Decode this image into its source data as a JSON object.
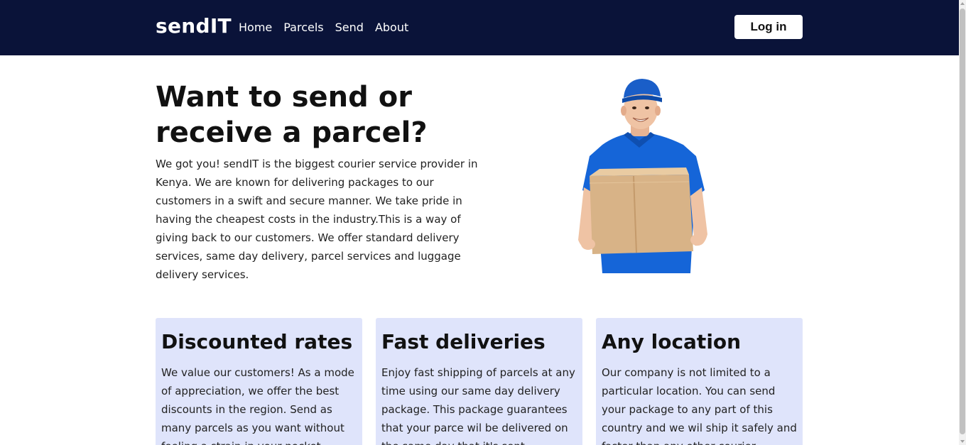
{
  "navbar": {
    "brand": "sendIT",
    "links": [
      "Home",
      "Parcels",
      "Send",
      "About"
    ],
    "login_label": "Log in",
    "background_color": "#0a1339"
  },
  "hero": {
    "title_line1": "Want to send or",
    "title_line2": "receive a parcel?",
    "description": "We got you! sendIT is the biggest courier service provider in Kenya. We are known for delivering packages to our customers in a swift and secure manner. We take pride in having the cheapest costs in the industry.This is a way of giving back to our customers. We offer standard delivery services, same day delivery, parcel services and luggage delivery services.",
    "image": "delivery-man-holding-box"
  },
  "features": [
    {
      "title": "Discounted rates",
      "text": "We value our customers! As a mode of appreciation, we offer the best discounts in the region. Send as many parcels as you want without feeling a strain in your pocket."
    },
    {
      "title": "Fast deliveries",
      "text": "Enjoy fast shipping of parcels at any time using our same day delivery package. This package guarantees that your parce wil be delivered on the same day that it's sent."
    },
    {
      "title": "Any location",
      "text": "Our company is not limited to a particular location. You can send your package to any part of this country and we wil ship it safely and faster than any other courier."
    }
  ],
  "colors": {
    "card_background": "#dfe4fb",
    "accent_blue": "#1565d8"
  }
}
